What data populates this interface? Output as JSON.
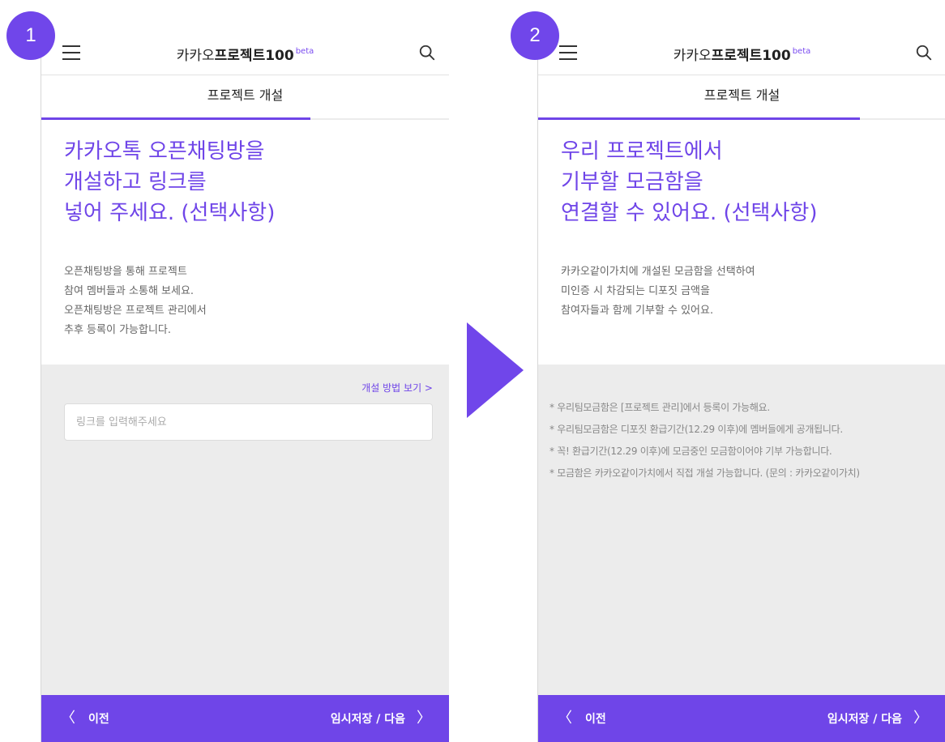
{
  "colors": {
    "accent": "#6f45e8",
    "badge": "#7046ea",
    "page_bg": "#ececec"
  },
  "step_badges": [
    "1",
    "2"
  ],
  "screens": [
    {
      "header": {
        "brand_light": "카카오",
        "brand_bold": "프로젝트100",
        "brand_beta": "beta",
        "menu_icon": "hamburger-menu-icon",
        "search_icon": "search-icon"
      },
      "subheader_title": "프로젝트 개설",
      "progress": 0.66,
      "title": "카카오톡 오픈채팅방을\n개설하고 링크를\n넣어 주세요. (선택사항)",
      "description": "오픈채팅방을 통해 프로젝트\n참여 멤버들과 소통해 보세요.\n오픈채팅방은 프로젝트 관리에서\n추후 등록이 가능합니다.",
      "howto_link": "개설 방법 보기 >",
      "input": {
        "placeholder": "링크를 입력해주세요",
        "value": ""
      },
      "footer": {
        "prev_label": "이전",
        "next_label": "임시저장 / 다음"
      }
    },
    {
      "header": {
        "brand_light": "카카오",
        "brand_bold": "프로젝트100",
        "brand_beta": "beta",
        "menu_icon": "hamburger-menu-icon",
        "search_icon": "search-icon"
      },
      "subheader_title": "프로젝트 개설",
      "progress": 0.79,
      "title": "우리 프로젝트에서\n기부할 모금함을\n연결할 수 있어요. (선택사항)",
      "description": "카카오같이가치에 개설된 모금함을 선택하여\n미인증 시 차감되는 디포짓 금액을\n참여자들과 함께 기부할 수 있어요.",
      "notes": [
        "* 우리팀모금함은 [프로젝트 관리]에서 등록이 가능해요.",
        "* 우리팀모금함은 디포짓 환급기간(12.29 이후)에 멤버들에게 공개됩니다.",
        "* 꼭! 환급기간(12.29 이후)에 모금중인 모금함이어야 기부 가능합니다.",
        "* 모금함은 카카오같이가치에서 직접 개설 가능합니다. (문의 : 카카오같이가치)"
      ],
      "footer": {
        "prev_label": "이전",
        "next_label": "임시저장 / 다음"
      }
    }
  ]
}
